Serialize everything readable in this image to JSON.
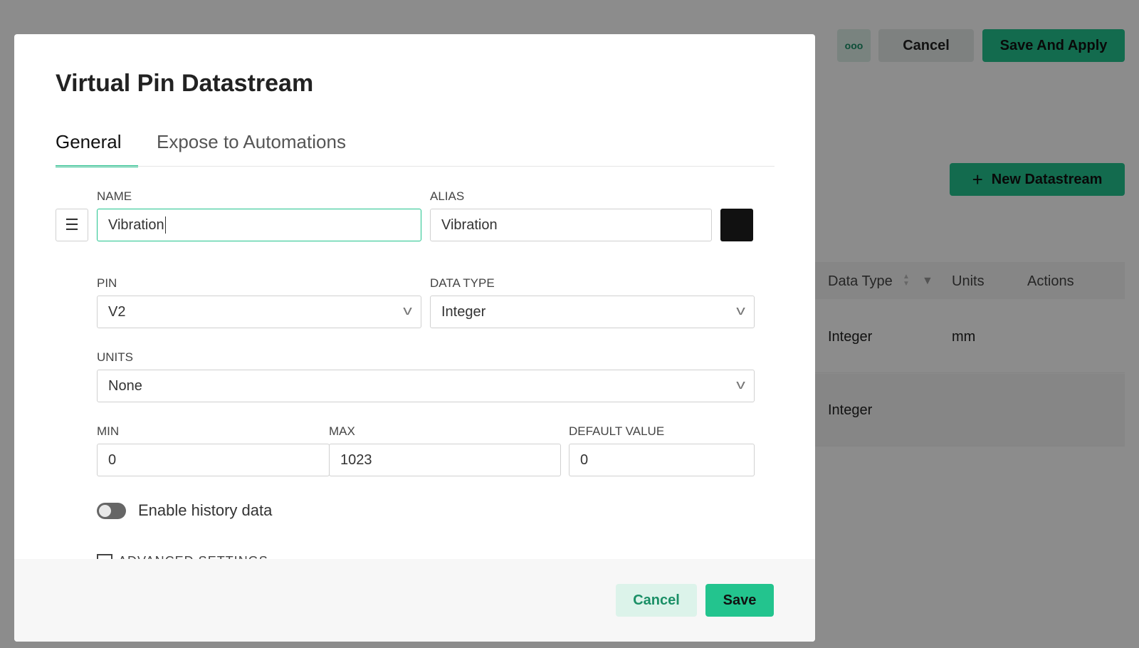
{
  "background": {
    "more_label": "ooo",
    "cancel_label": "Cancel",
    "save_apply_label": "Save And Apply",
    "new_datastream_label": "New Datastream",
    "table": {
      "headers": [
        "Data Type",
        "Units",
        "Actions"
      ],
      "rows": [
        [
          "Integer",
          "mm"
        ],
        [
          "Integer",
          ""
        ]
      ]
    }
  },
  "dialog": {
    "title": "Virtual Pin Datastream",
    "tabs": [
      {
        "label": "General",
        "active": true
      },
      {
        "label": "Expose to Automations",
        "active": false
      }
    ],
    "name": {
      "label": "NAME",
      "value": "Vibration"
    },
    "alias": {
      "label": "ALIAS",
      "value": "Vibration"
    },
    "color": "#111111",
    "pin": {
      "label": "PIN",
      "value": "V2"
    },
    "data_type": {
      "label": "DATA TYPE",
      "value": "Integer"
    },
    "units": {
      "label": "UNITS",
      "value": "None"
    },
    "min": {
      "label": "MIN",
      "value": "0"
    },
    "max": {
      "label": "MAX",
      "value": "1023"
    },
    "default": {
      "label": "DEFAULT VALUE",
      "value": "0"
    },
    "history": {
      "label": "Enable history data",
      "enabled": false
    },
    "advanced_label": "ADVANCED SETTINGS",
    "cancel_label": "Cancel",
    "save_label": "Save"
  },
  "colors": {
    "accent": "#23c48e",
    "dark_accent": "#1a9c6f"
  }
}
